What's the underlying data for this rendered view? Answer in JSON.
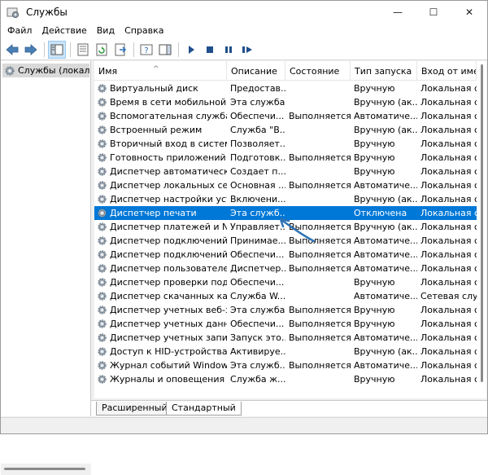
{
  "window": {
    "title": "Службы",
    "minimize_glyph": "—",
    "maximize_glyph": "☐",
    "close_glyph": "✕"
  },
  "menu": [
    "Файл",
    "Действие",
    "Вид",
    "Справка"
  ],
  "toolbar": {
    "icons": [
      "back-arrow-icon",
      "forward-arrow-icon",
      "show-hide-console-tree-icon",
      "properties-icon",
      "refresh-icon",
      "export-list-icon",
      "help-icon",
      "show-action-pane-icon",
      "start-service-icon",
      "stop-service-icon",
      "pause-service-icon",
      "restart-service-icon"
    ]
  },
  "tree": {
    "selected_label": "Службы (локальн"
  },
  "columns": [
    "Имя",
    "Описание",
    "Состояние",
    "Тип запуска",
    "Вход от имени"
  ],
  "services": [
    {
      "name": "Виртуальный диск",
      "desc": "Предостав...",
      "state": "",
      "start": "Вручную",
      "logon": "Локальная си"
    },
    {
      "name": "Время в сети мобильной о...",
      "desc": "Эта служба...",
      "state": "",
      "start": "Вручную (ак...",
      "logon": "Локальная сл"
    },
    {
      "name": "Вспомогательная служба IP",
      "desc": "Обеспечи...",
      "state": "Выполняется",
      "start": "Автоматиче...",
      "logon": "Локальная си"
    },
    {
      "name": "Встроенный режим",
      "desc": "Служба \"В...",
      "state": "",
      "start": "Вручную (ак...",
      "logon": "Локальная си"
    },
    {
      "name": "Вторичный вход в систему",
      "desc": "Позволяет...",
      "state": "",
      "start": "Вручную",
      "logon": "Локальная си"
    },
    {
      "name": "Готовность приложений",
      "desc": "Подготовк...",
      "state": "Выполняется",
      "start": "Вручную",
      "logon": "Локальная си"
    },
    {
      "name": "Диспетчер автоматически...",
      "desc": "Создает п...",
      "state": "",
      "start": "Вручную",
      "logon": "Локальная си"
    },
    {
      "name": "Диспетчер локальных сеа...",
      "desc": "Основная ...",
      "state": "Выполняется",
      "start": "Автоматиче...",
      "logon": "Локальная си"
    },
    {
      "name": "Диспетчер настройки устр...",
      "desc": "Включени...",
      "state": "",
      "start": "Вручную (ак...",
      "logon": "Локальная си"
    },
    {
      "name": "Диспетчер печати",
      "desc": "Эта служб...",
      "state": "",
      "start": "Отключена",
      "logon": "Локальная си"
    },
    {
      "name": "Диспетчер платежей и NF...",
      "desc": "Управляет...",
      "state": "Выполняется",
      "start": "Вручную (ак...",
      "logon": "Локальная сл"
    },
    {
      "name": "Диспетчер подключений ...",
      "desc": "Принимае...",
      "state": "Выполняется",
      "start": "Автоматиче...",
      "logon": "Локальная си"
    },
    {
      "name": "Диспетчер подключений ...",
      "desc": "Обеспечи...",
      "state": "Выполняется",
      "start": "Автоматиче...",
      "logon": "Локальная си"
    },
    {
      "name": "Диспетчер пользователей",
      "desc": "Диспетчер...",
      "state": "Выполняется",
      "start": "Автоматиче...",
      "logon": "Локальная си"
    },
    {
      "name": "Диспетчер проверки подл...",
      "desc": "Обеспечи...",
      "state": "",
      "start": "Вручную",
      "logon": "Локальная си"
    },
    {
      "name": "Диспетчер скачанных карт",
      "desc": "Служба W...",
      "state": "",
      "start": "Автоматиче...",
      "logon": "Сетевая служ"
    },
    {
      "name": "Диспетчер учетных веб-за...",
      "desc": "Эта служба...",
      "state": "Выполняется",
      "start": "Вручную",
      "logon": "Локальная си"
    },
    {
      "name": "Диспетчер учетных данных",
      "desc": "Обеспечи...",
      "state": "Выполняется",
      "start": "Вручную",
      "logon": "Локальная си"
    },
    {
      "name": "Диспетчер учетных записе...",
      "desc": "Запуск это...",
      "state": "Выполняется",
      "start": "Автоматиче...",
      "logon": "Локальная си"
    },
    {
      "name": "Доступ к HID-устройствам",
      "desc": "Активируе...",
      "state": "",
      "start": "Вручную (ак...",
      "logon": "Локальная си"
    },
    {
      "name": "Журнал событий Windows",
      "desc": "Эта служб...",
      "state": "Выполняется",
      "start": "Автоматиче...",
      "logon": "Локальная сл"
    },
    {
      "name": "Журналы и оповещения п...",
      "desc": "Служба ж...",
      "state": "",
      "start": "Вручную",
      "logon": "Локальная сл"
    }
  ],
  "selected_index": 9,
  "tabs": [
    "Расширенный",
    "Стандартный"
  ],
  "colors": {
    "selection": "#0078d7",
    "annotation_arrow": "#2e74b5"
  }
}
